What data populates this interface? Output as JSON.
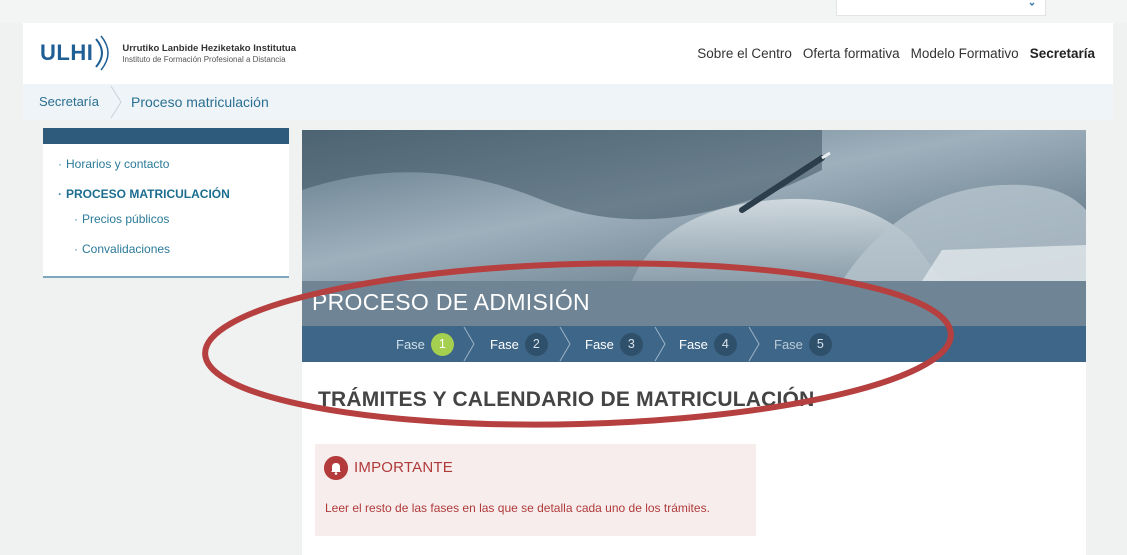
{
  "logo": {
    "mark": "ULHI",
    "line1": "Urrutiko Lanbide Heziketako Institutua",
    "line2": "Instituto de Formación Profesional a Distancia"
  },
  "nav": [
    {
      "label": "Sobre el Centro"
    },
    {
      "label": "Oferta formativa"
    },
    {
      "label": "Modelo Formativo"
    },
    {
      "label": "Secretaría",
      "active": true
    }
  ],
  "breadcrumb": [
    "Secretaría",
    "Proceso matriculación"
  ],
  "sidebar": {
    "items": [
      {
        "label": "Horarios y contacto"
      },
      {
        "label": "PROCESO MATRICULACIÓN"
      },
      {
        "label": "Precios públicos"
      },
      {
        "label": "Convalidaciones"
      }
    ]
  },
  "hero_title": "PROCESO DE ADMISIÓN",
  "phases": [
    {
      "label": "Fase",
      "number": "1",
      "state": "current"
    },
    {
      "label": "Fase",
      "number": "2",
      "state": "normal"
    },
    {
      "label": "Fase",
      "number": "3",
      "state": "normal"
    },
    {
      "label": "Fase",
      "number": "4",
      "state": "normal"
    },
    {
      "label": "Fase",
      "number": "5",
      "state": "dim"
    }
  ],
  "section_title": "TRÁMITES Y CALENDARIO DE MATRICULACIÓN",
  "notice": {
    "title": "IMPORTANTE",
    "text": "Leer el resto de las fases en las que se detalla cada uno de los trámites."
  },
  "colors": {
    "brand_blue": "#1f5f96",
    "link_teal": "#2b7a98",
    "phase_bar": "#3e6688",
    "phase_current": "#a5cf4f",
    "notice_red": "#b03a3a",
    "annotation_red": "#b5403f"
  },
  "icons": {
    "search": "search-icon",
    "notice": "bell-icon",
    "breadcrumb_separator": "chevron-right-icon"
  }
}
